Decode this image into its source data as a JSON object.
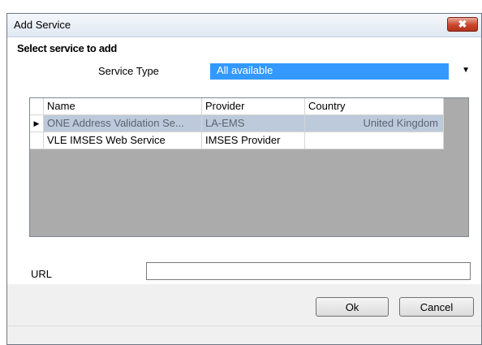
{
  "window": {
    "title": "Add Service",
    "close_glyph": "✖"
  },
  "section": {
    "title": "Select service to add"
  },
  "service_type": {
    "label": "Service Type",
    "selected": "All available",
    "arrow": "▼"
  },
  "grid": {
    "columns": [
      "Name",
      "Provider",
      "Country"
    ],
    "current_row_marker": "▶",
    "rows": [
      {
        "name": "ONE Address Validation Se...",
        "provider": "LA-EMS",
        "country": "United Kingdom"
      },
      {
        "name": "VLE IMSES Web Service",
        "provider": "IMSES Provider",
        "country": ""
      }
    ]
  },
  "url": {
    "label": "URL",
    "value": ""
  },
  "buttons": {
    "ok": "Ok",
    "cancel": "Cancel"
  },
  "colors": {
    "selection": "#3399ff",
    "selected_row": "#bccadb",
    "grid_empty": "#ababab"
  }
}
